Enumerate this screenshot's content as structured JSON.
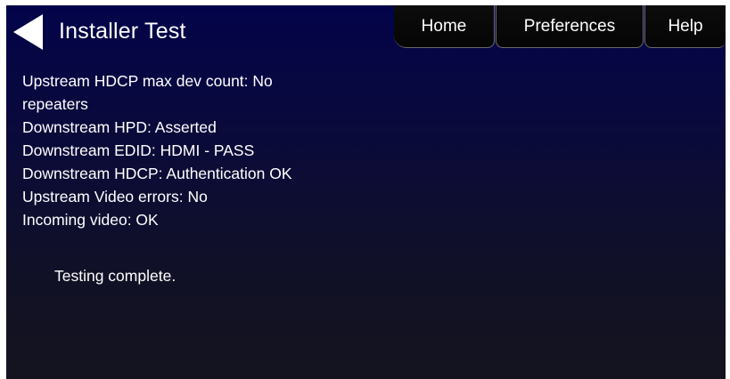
{
  "header": {
    "title": "Installer Test",
    "back_icon": "back-arrow-icon",
    "tabs": [
      {
        "label": "Home"
      },
      {
        "label": "Preferences"
      },
      {
        "label": "Help"
      }
    ]
  },
  "results": {
    "lines": [
      "Upstream HDCP max dev count: No repeaters",
      "Downstream HPD: Asserted",
      "Downstream EDID: HDMI - PASS",
      "Downstream HDCP: Authentication OK",
      "Upstream Video errors: No",
      "Incoming video: OK"
    ]
  },
  "status": "Testing complete.",
  "colors": {
    "background_top": "#03034a",
    "background_bottom": "#141420",
    "text": "#ffffff",
    "tab_background": "#070707"
  }
}
